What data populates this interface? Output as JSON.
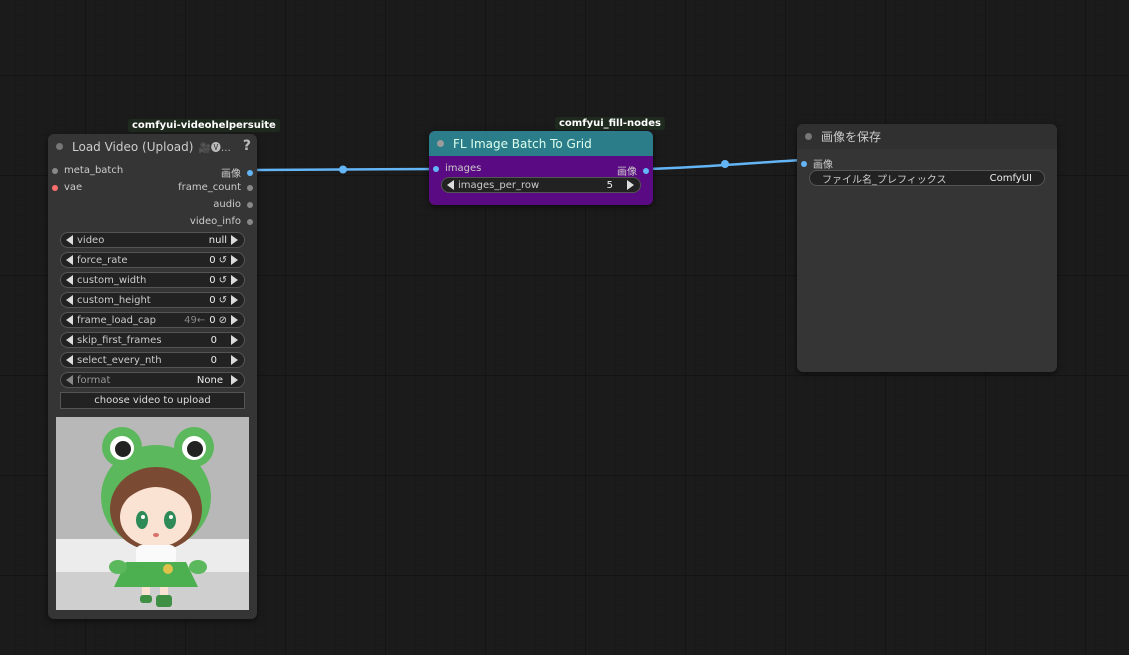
{
  "colors": {
    "image_link": "#64b5f6",
    "vae_socket": "#ff6e6e",
    "fill_node_title": "#2b7d8a",
    "fill_node_body": "#5a0a82",
    "node_body": "#353535"
  },
  "badges": {
    "videohelper": "comfyui-videohelpersuite",
    "fill_nodes": "comfyui_fill-nodes"
  },
  "load_video": {
    "title": "Load Video (Upload)",
    "title_suffix": "🎥🅥…",
    "help": "?",
    "inputs": [
      "meta_batch",
      "vae"
    ],
    "outputs": [
      "画像",
      "frame_count",
      "audio",
      "video_info"
    ],
    "widgets": [
      {
        "label": "video",
        "value": "null",
        "extra": "",
        "icon": ""
      },
      {
        "label": "force_rate",
        "value": "0",
        "extra": "",
        "icon": "↺"
      },
      {
        "label": "custom_width",
        "value": "0",
        "extra": "",
        "icon": "↺"
      },
      {
        "label": "custom_height",
        "value": "0",
        "extra": "",
        "icon": "↺"
      },
      {
        "label": "frame_load_cap",
        "value": "0",
        "extra": "49←",
        "icon": "⊘"
      },
      {
        "label": "skip_first_frames",
        "value": "0",
        "extra": "",
        "icon": ""
      },
      {
        "label": "select_every_nth",
        "value": "0",
        "extra": "",
        "icon": ""
      },
      {
        "label": "format",
        "value": "None",
        "extra": "",
        "icon": ""
      }
    ],
    "upload_button": "choose video to upload"
  },
  "fill_grid": {
    "title": "FL Image Batch To Grid",
    "input": "images",
    "output": "画像",
    "widget": {
      "label": "images_per_row",
      "value": "5"
    }
  },
  "save_image": {
    "title": "画像を保存",
    "input": "画像",
    "widget": {
      "label": "ファイル名_プレフィックス",
      "value": "ComfyUI"
    }
  }
}
